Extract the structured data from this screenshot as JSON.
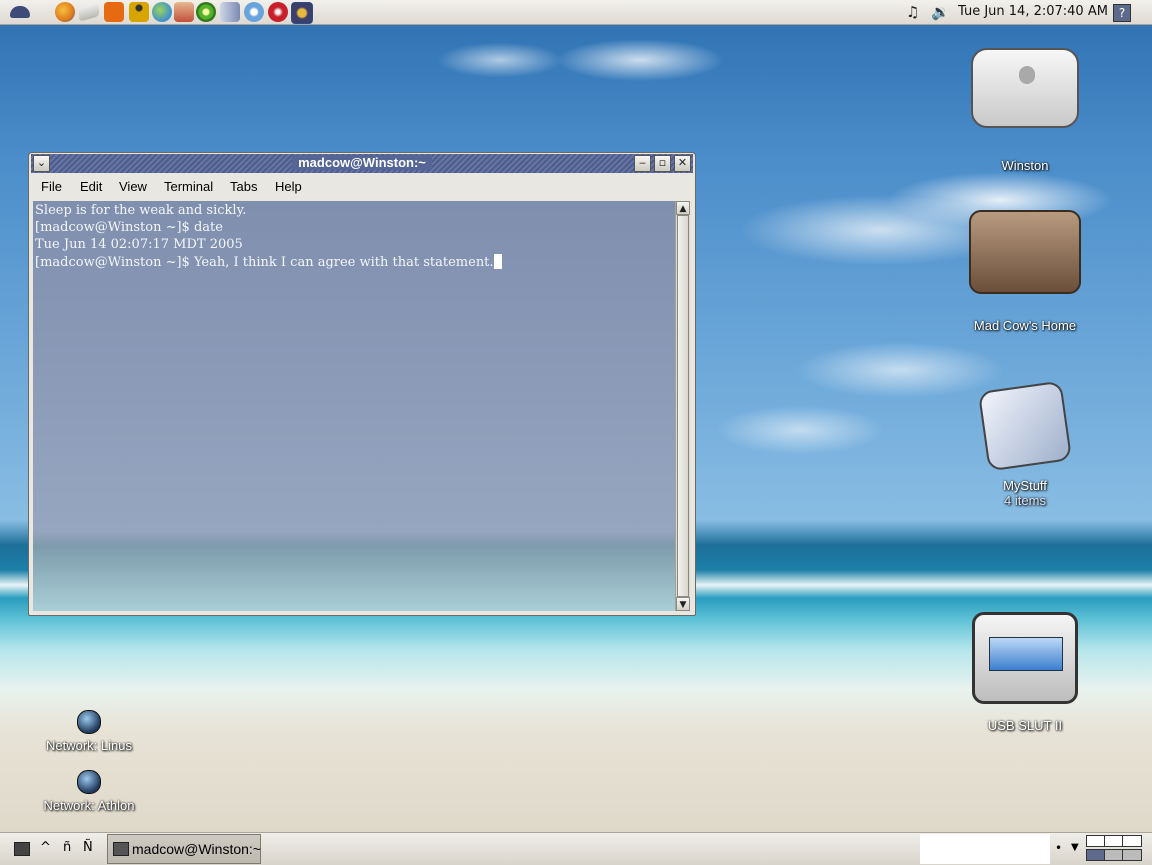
{
  "top_panel": {
    "launchers": [
      {
        "name": "main-menu-hat-icon",
        "color": "#3e4a78"
      },
      {
        "name": "firefox-icon",
        "color": "#e07a1c"
      },
      {
        "name": "mail-icon",
        "color": "#b8b8b0"
      },
      {
        "name": "rss-feed-icon",
        "color": "#e56a12"
      },
      {
        "name": "accessibility-icon",
        "color": "#d8a400"
      },
      {
        "name": "globe-icon",
        "color": "#3b8fd0"
      },
      {
        "name": "tools-icon",
        "color": "#c0513a"
      },
      {
        "name": "green-circle-icon",
        "color": "#56b12c"
      },
      {
        "name": "mixer-icon",
        "color": "#7b8ab0"
      },
      {
        "name": "itunes-icon",
        "color": "#6aa3dc"
      },
      {
        "name": "no-entry-icon",
        "color": "#c8202a"
      },
      {
        "name": "media-player-icon",
        "color": "#3b3f6a"
      }
    ],
    "clock": "Tue Jun 14,  2:07:40 AM",
    "help_label": "?"
  },
  "window": {
    "title": "madcow@Winston:~",
    "menu": [
      "File",
      "Edit",
      "View",
      "Terminal",
      "Tabs",
      "Help"
    ],
    "terminal_lines": [
      "Sleep is for the weak and sickly.",
      "[madcow@Winston ~]$ date",
      "Tue Jun 14 02:07:17 MDT 2005",
      "[madcow@Winston ~]$ Yeah, I think I can agree with that statement."
    ]
  },
  "desktop_icons": [
    {
      "label": "Winston"
    },
    {
      "label": "Mad Cow's Home"
    },
    {
      "label": "MyStuff",
      "sub": "4 items"
    },
    {
      "label": "USB SLUT II"
    },
    {
      "label": "Network: Linus"
    },
    {
      "label": "Network: Athlon"
    }
  ],
  "bottom_panel": {
    "task_label": "madcow@Winston:~",
    "applet_glyphs": [
      "^",
      "ñ",
      "Ñ"
    ]
  }
}
